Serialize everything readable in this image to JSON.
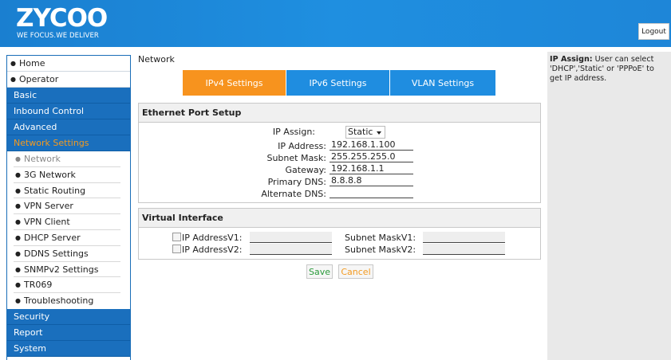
{
  "header": {
    "logo_text": "ZYCOO",
    "slogan": "WE FOCUS.WE DELIVER",
    "logout_label": "Logout",
    "brand_color": "#1f8fe0"
  },
  "sidebar": {
    "top_items": [
      "Home",
      "Operator"
    ],
    "sections": [
      {
        "label": "Basic"
      },
      {
        "label": "Inbound Control"
      },
      {
        "label": "Advanced"
      },
      {
        "label": "Network Settings",
        "active": true
      }
    ],
    "network_items": [
      {
        "label": "Network",
        "current": true
      },
      {
        "label": "3G Network"
      },
      {
        "label": "Static Routing"
      },
      {
        "label": "VPN Server"
      },
      {
        "label": "VPN Client"
      },
      {
        "label": "DHCP Server"
      },
      {
        "label": "DDNS Settings"
      },
      {
        "label": "SNMPv2 Settings"
      },
      {
        "label": "TR069"
      },
      {
        "label": "Troubleshooting"
      }
    ],
    "bottom_sections": [
      {
        "label": "Security"
      },
      {
        "label": "Report"
      },
      {
        "label": "System"
      }
    ]
  },
  "page": {
    "title": "Network"
  },
  "tabs": [
    {
      "label": "IPv4 Settings",
      "active": true
    },
    {
      "label": "IPv6 Settings"
    },
    {
      "label": "VLAN Settings"
    }
  ],
  "ethernet": {
    "title": "Ethernet Port Setup",
    "ip_assign_label": "IP Assign:",
    "ip_assign_value": "Static",
    "ip_address_label": "IP Address:",
    "ip_address_value": "192.168.1.100",
    "subnet_mask_label": "Subnet Mask:",
    "subnet_mask_value": "255.255.255.0",
    "gateway_label": "Gateway:",
    "gateway_value": "192.168.1.1",
    "primary_dns_label": "Primary DNS:",
    "primary_dns_value": "8.8.8.8",
    "alternate_dns_label": "Alternate DNS:",
    "alternate_dns_value": ""
  },
  "virtual": {
    "title": "Virtual Interface",
    "ip1_label": "IP AddressV1:",
    "ip2_label": "IP AddressV2:",
    "mask1_label": "Subnet MaskV1:",
    "mask2_label": "Subnet MaskV2:"
  },
  "actions": {
    "save_label": "Save",
    "cancel_label": "Cancel"
  },
  "help": {
    "heading": "IP Assign:",
    "text": " User can select 'DHCP','Static' or 'PPPoE' to get IP address."
  }
}
